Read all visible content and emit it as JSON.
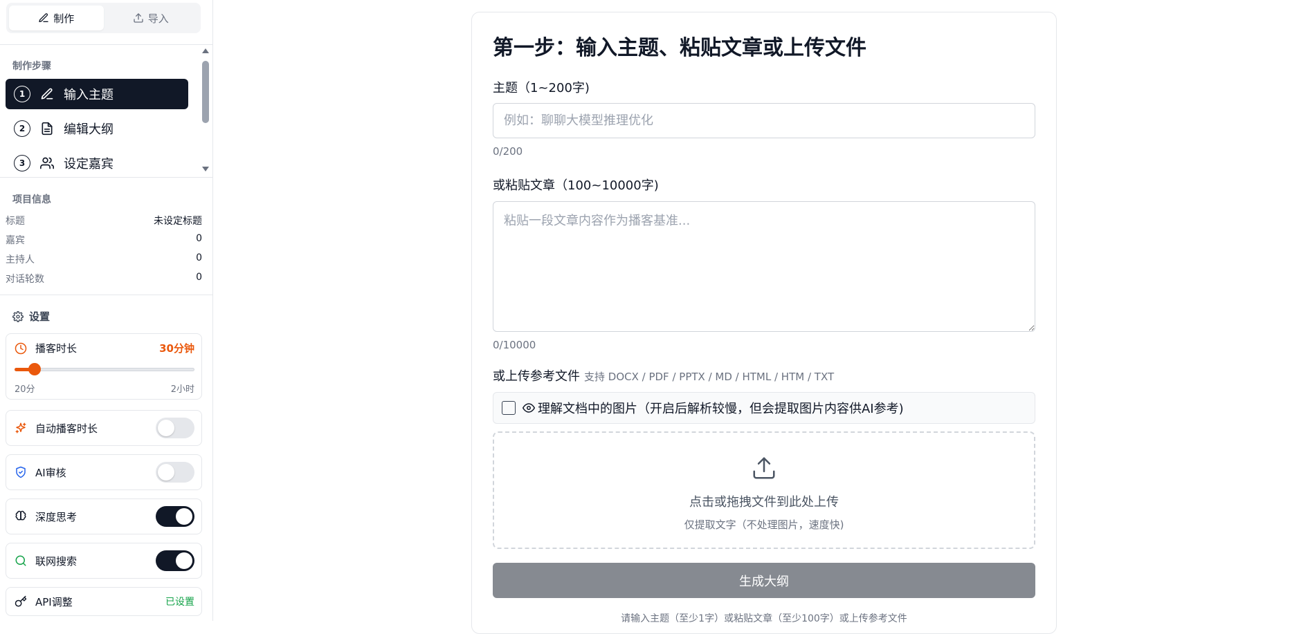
{
  "mode_tabs": {
    "create": "制作",
    "import": "导入"
  },
  "steps_section": {
    "title": "制作步骤",
    "items": [
      {
        "num": "1",
        "label": "输入主题",
        "icon": "pencil-icon"
      },
      {
        "num": "2",
        "label": "编辑大纲",
        "icon": "document-icon"
      },
      {
        "num": "3",
        "label": "设定嘉宾",
        "icon": "users-icon"
      }
    ]
  },
  "project_info": {
    "title": "项目信息",
    "rows": [
      {
        "label": "标题",
        "value": "未设定标题"
      },
      {
        "label": "嘉宾",
        "value": "0"
      },
      {
        "label": "主持人",
        "value": "0"
      },
      {
        "label": "对话轮数",
        "value": "0"
      }
    ]
  },
  "settings": {
    "title": "设置",
    "duration": {
      "label": "播客时长",
      "value": "30分钟",
      "min_label": "20分",
      "max_label": "2小时",
      "fraction": 0.11
    },
    "auto_duration": {
      "label": "自动播客时长",
      "on": false
    },
    "ai_review": {
      "label": "AI审核",
      "on": false
    },
    "deep_thinking": {
      "label": "深度思考",
      "on": true
    },
    "web_search": {
      "label": "联网搜索",
      "on": true
    },
    "api": {
      "label": "API调整",
      "status": "已设置"
    }
  },
  "colors": {
    "accent": "#ea580c",
    "dark": "#111827",
    "success": "#16a34a"
  },
  "main": {
    "title": "第一步：输入主题、粘贴文章或上传文件",
    "topic": {
      "label": "主题（1~200字)",
      "placeholder": "例如：聊聊大模型推理优化",
      "counter": "0/200"
    },
    "article": {
      "label": "或粘贴文章（100~10000字)",
      "placeholder": "粘贴一段文章内容作为播客基准...",
      "counter": "0/10000"
    },
    "upload": {
      "label": "或上传参考文件",
      "formats": "支持 DOCX / PDF / PPTX / MD / HTML / HTM / TXT",
      "checkbox_label": "理解文档中的图片（开启后解析较慢，但会提取图片内容供AI参考)",
      "drop_main": "点击或拖拽文件到此处上传",
      "drop_sub": "仅提取文字（不处理图片，速度快)"
    },
    "generate_button": "生成大纲",
    "footnote": "请输入主题（至少1字）或粘贴文章（至少100字）或上传参考文件"
  }
}
